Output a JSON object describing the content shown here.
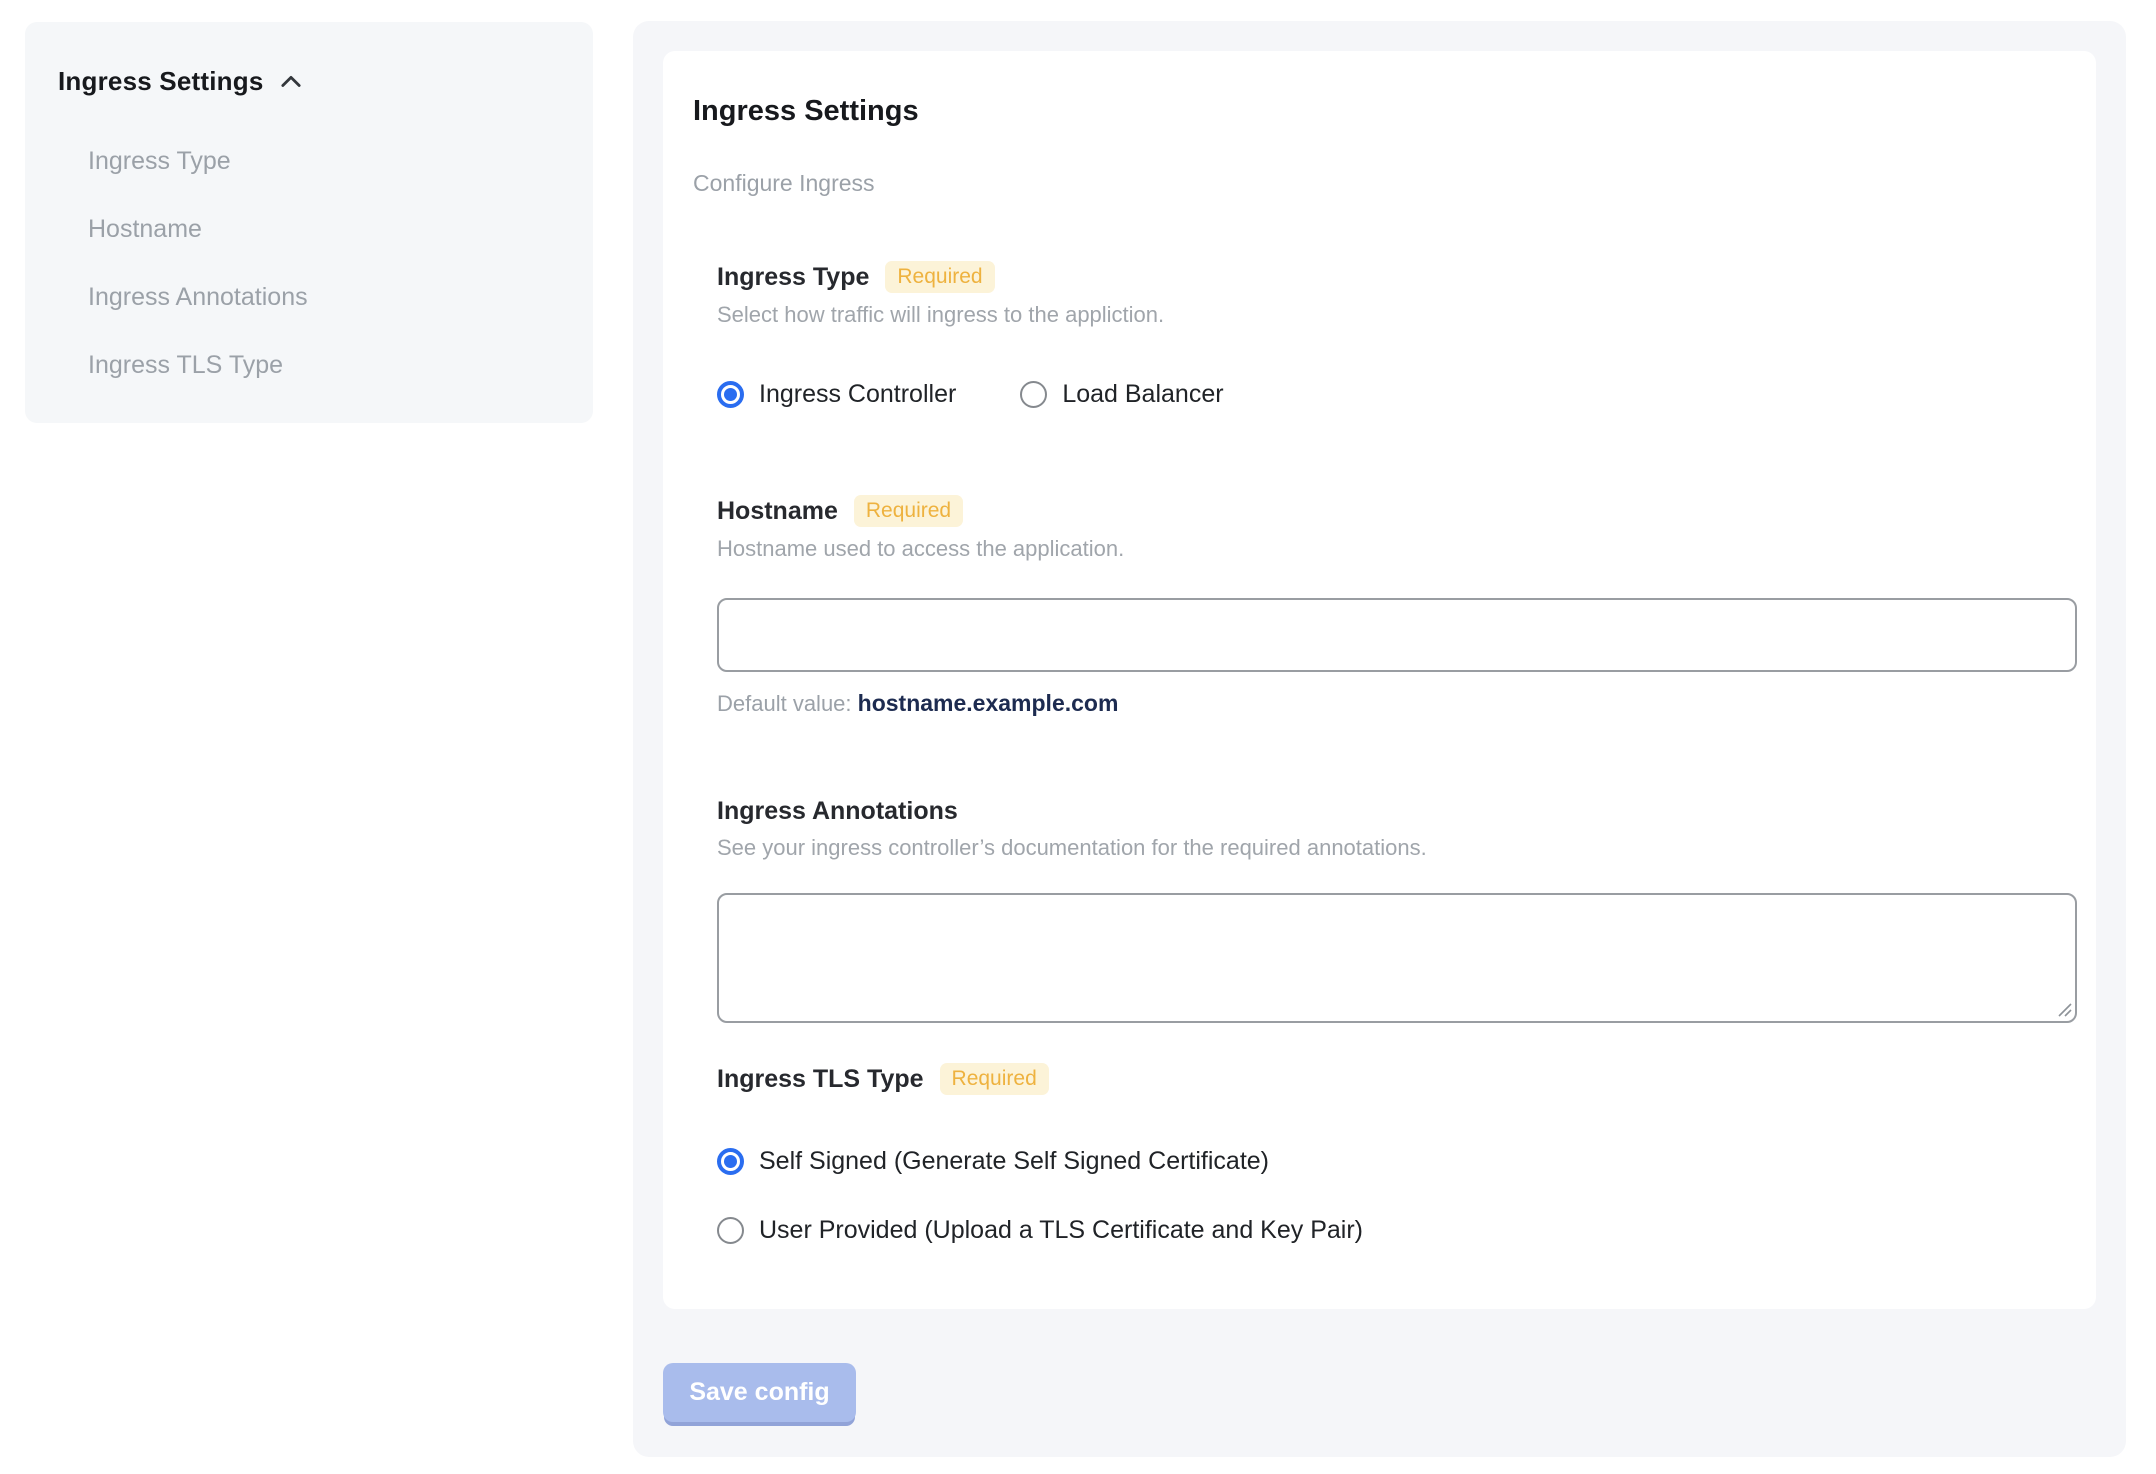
{
  "sidebar": {
    "title": "Ingress Settings",
    "chevron_icon": "chevron-up",
    "items": [
      {
        "label": "Ingress Type"
      },
      {
        "label": "Hostname"
      },
      {
        "label": "Ingress Annotations"
      },
      {
        "label": "Ingress TLS Type"
      }
    ]
  },
  "main": {
    "title": "Ingress Settings",
    "subtitle": "Configure Ingress",
    "required_badge": "Required",
    "sections": {
      "ingress_type": {
        "label": "Ingress Type",
        "required": true,
        "description": "Select how traffic will ingress to the appliction.",
        "options": [
          {
            "label": "Ingress Controller",
            "selected": true
          },
          {
            "label": "Load Balancer",
            "selected": false
          }
        ]
      },
      "hostname": {
        "label": "Hostname",
        "required": true,
        "description": "Hostname used to access the application.",
        "input_value": "",
        "default_value_label": "Default value:",
        "default_value": "hostname.example.com"
      },
      "ingress_annotations": {
        "label": "Ingress Annotations",
        "required": false,
        "description": "See your ingress controller’s documentation for the required annotations.",
        "textarea_value": ""
      },
      "ingress_tls_type": {
        "label": "Ingress TLS Type",
        "required": true,
        "options": [
          {
            "label": "Self Signed (Generate Self Signed Certificate)",
            "selected": true
          },
          {
            "label": "User Provided (Upload a TLS Certificate and Key Pair)",
            "selected": false
          }
        ]
      }
    },
    "save_button": "Save config"
  },
  "colors": {
    "accent_blue": "#2a6df0",
    "badge_bg": "#fcf3d8",
    "badge_text": "#eeb23f",
    "panel_bg": "#f5f6f9",
    "sidebar_bg": "#f5f7f9",
    "default_value_text": "#1d2b50",
    "save_button_bg": "#a9bcec",
    "muted_text": "#9ba1a8"
  }
}
